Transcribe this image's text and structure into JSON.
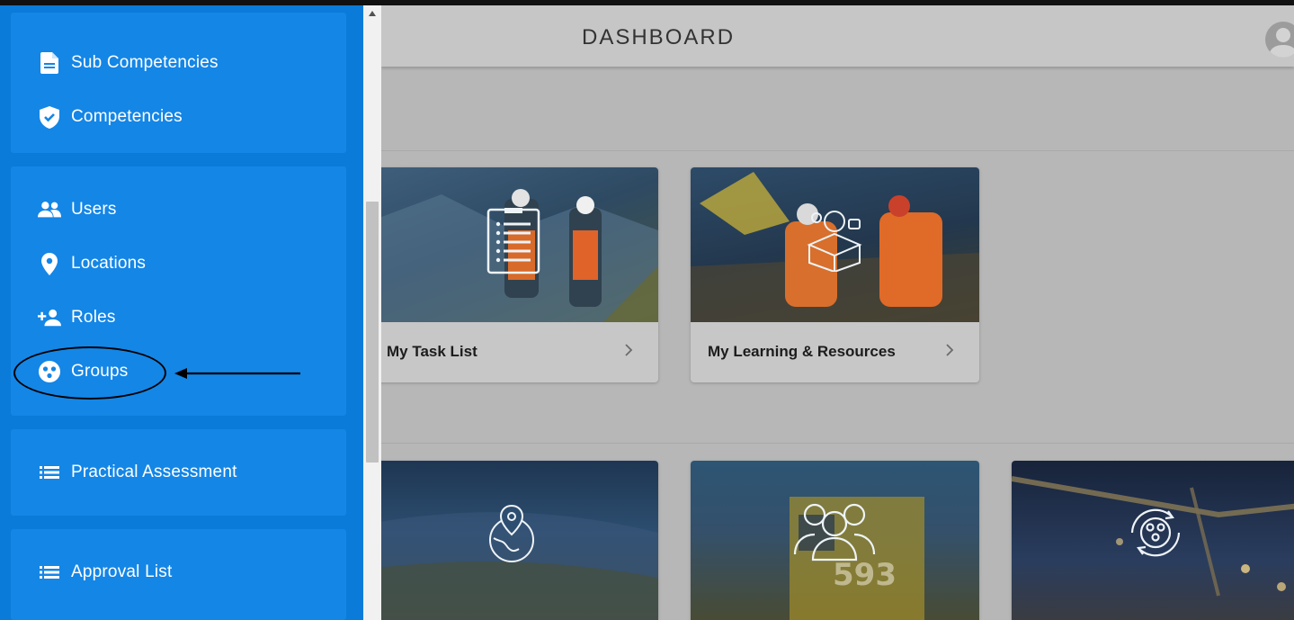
{
  "header": {
    "title": "DASHBOARD"
  },
  "sidebar": {
    "items": [
      {
        "label": "Sub Competencies",
        "icon": "document-icon"
      },
      {
        "label": "Competencies",
        "icon": "shield-check-icon"
      },
      {
        "label": "Users",
        "icon": "users-icon"
      },
      {
        "label": "Locations",
        "icon": "location-pin-icon"
      },
      {
        "label": "Roles",
        "icon": "add-person-icon"
      },
      {
        "label": "Groups",
        "icon": "groups-icon"
      },
      {
        "label": "Practical Assessment",
        "icon": "list-icon"
      },
      {
        "label": "Approval List",
        "icon": "list-icon"
      }
    ]
  },
  "cards": [
    {
      "label": "My Task List",
      "icon": "checklist-icon"
    },
    {
      "label": "My Learning & Resources",
      "icon": "brain-box-icon"
    },
    {
      "label": "",
      "icon": "globe-pin-icon"
    },
    {
      "label": "",
      "icon": "people-icon"
    },
    {
      "label": "",
      "icon": "group-cycle-icon"
    }
  ],
  "colors": {
    "sidebar_bg": "#0a7bd9",
    "sidebar_group": "#1486e6",
    "overlay": "#b7b7b7"
  }
}
